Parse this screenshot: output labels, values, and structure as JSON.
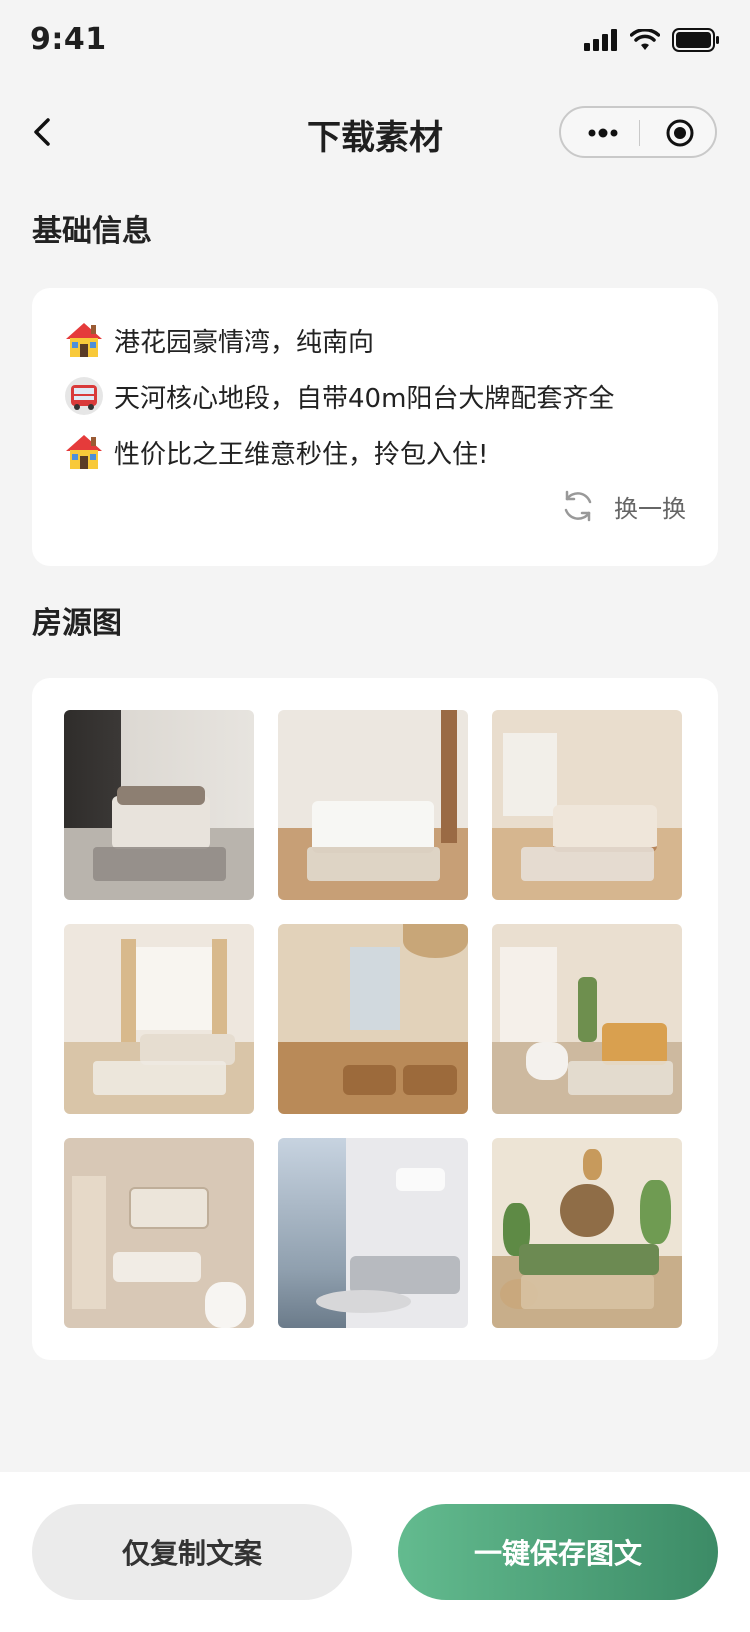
{
  "status_bar": {
    "time": "9:41"
  },
  "nav": {
    "title": "下载素材"
  },
  "basic_info": {
    "title": "基础信息",
    "lines": [
      {
        "icon": "house-icon",
        "text": "港花园豪情湾，纯南向"
      },
      {
        "icon": "bus-icon",
        "text": "天河核心地段，自带40m阳台大牌配套齐全"
      },
      {
        "icon": "house-icon",
        "text": "性价比之王维意秒住，拎包入住!"
      }
    ],
    "refresh_label": "换一换"
  },
  "photos": {
    "title": "房源图",
    "items": [
      {
        "name": "bedroom-dark-headboard"
      },
      {
        "name": "bedroom-mattress"
      },
      {
        "name": "bedroom-wood-bed"
      },
      {
        "name": "living-room-beige-sofa"
      },
      {
        "name": "dining-living-room"
      },
      {
        "name": "living-room-plant"
      },
      {
        "name": "bathroom-vanity"
      },
      {
        "name": "living-room-grey-sofa"
      },
      {
        "name": "living-room-green-sofa"
      }
    ]
  },
  "actions": {
    "copy_label": "仅复制文案",
    "save_label": "一键保存图文"
  },
  "colors": {
    "accent_start": "#63bb8f",
    "accent_end": "#3c8b66",
    "background": "#f4f4f4"
  }
}
